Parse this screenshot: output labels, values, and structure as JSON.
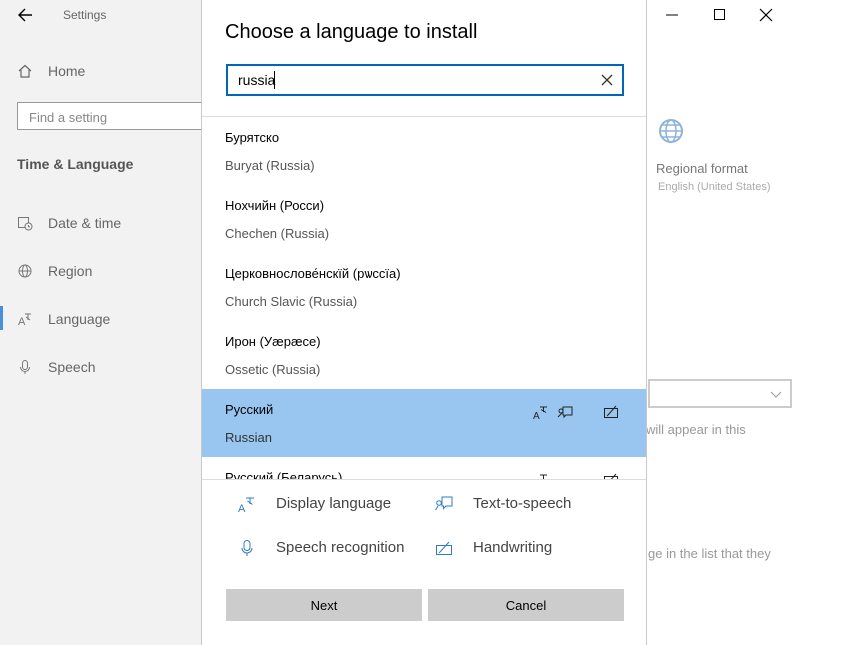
{
  "app": {
    "title": "Settings"
  },
  "sidebar": {
    "home": "Home",
    "search_placeholder": "Find a setting",
    "section": "Time & Language",
    "items": [
      {
        "label": "Date & time",
        "icon": "calendar-clock-icon"
      },
      {
        "label": "Region",
        "icon": "globe-icon"
      },
      {
        "label": "Language",
        "icon": "language-icon",
        "active": true
      },
      {
        "label": "Speech",
        "icon": "microphone-icon"
      }
    ]
  },
  "background": {
    "regional_format_label": "Regional format",
    "regional_format_value": "English (United States)",
    "partial_text_1": "will appear in this",
    "partial_text_2": "ge in the list that they"
  },
  "dialog": {
    "title": "Choose a language to install",
    "search_value": "russia",
    "languages": [
      {
        "native": "Бурятско",
        "english": "Buryat (Russia)"
      },
      {
        "native": "Нохчийн (Росси)",
        "english": "Chechen (Russia)"
      },
      {
        "native": "Церковнослове́нскїй (рѡссїа)",
        "english": "Church Slavic (Russia)"
      },
      {
        "native": "Ирон (Уæрæсе)",
        "english": "Ossetic (Russia)"
      },
      {
        "native": "Русский",
        "english": "Russian",
        "selected": true
      },
      {
        "native": "Русский (Беларусь)",
        "english": ""
      }
    ],
    "legend": {
      "display_language": "Display language",
      "text_to_speech": "Text-to-speech",
      "speech_recognition": "Speech recognition",
      "handwriting": "Handwriting"
    },
    "buttons": {
      "next": "Next",
      "cancel": "Cancel"
    }
  },
  "colors": {
    "accent": "#0067b8",
    "selected_row": "#99c6f0",
    "button": "#cccccc"
  }
}
